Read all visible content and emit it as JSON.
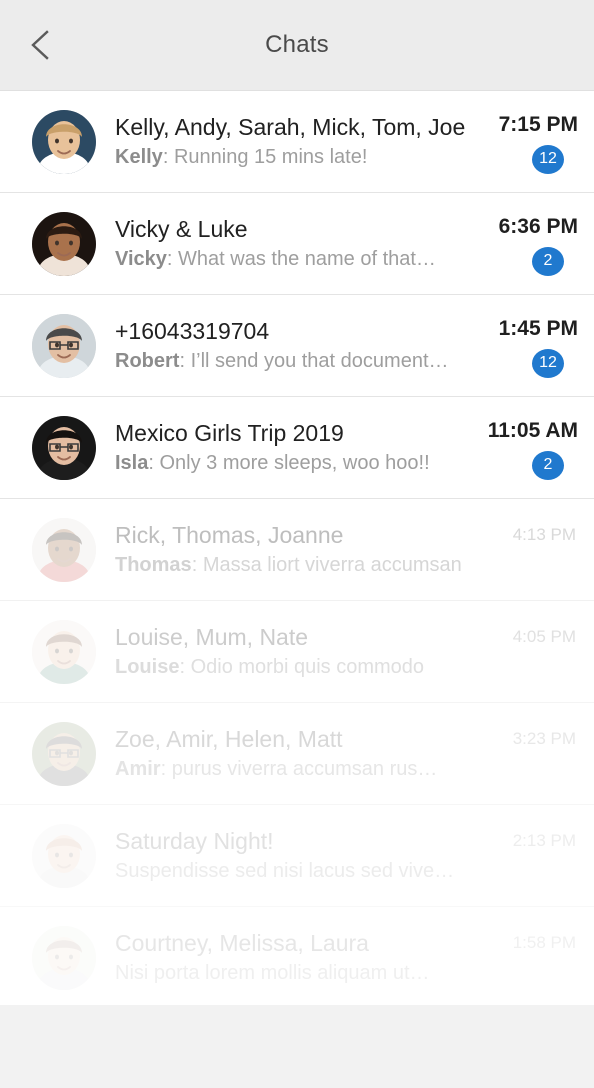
{
  "header": {
    "title": "Chats",
    "back_icon": "chevron-left-icon",
    "background": "#ececec"
  },
  "theme": {
    "badge_color": "#2079ce",
    "title_color": "#212121",
    "preview_color": "#9e9e9e",
    "divider_color": "#e4e4e4",
    "footer_color": "#f2f2f2"
  },
  "chats": [
    {
      "title": "Kelly, Andy, Sarah, Mick, Tom, Joe",
      "sender": "Kelly",
      "preview": "Running 15 mins late!",
      "time": "7:15 PM",
      "badge": "12",
      "unread": true,
      "avatar": "photo-young-man-blond"
    },
    {
      "title": "Vicky & Luke",
      "sender": "Vicky",
      "preview": "What was the name of that…",
      "time": "6:36 PM",
      "badge": "2",
      "unread": true,
      "avatar": "photo-woman-curly-hair"
    },
    {
      "title": "+16043319704",
      "sender": "Robert",
      "preview": "I’ll send you that document…",
      "time": "1:45 PM",
      "badge": "12",
      "unread": true,
      "avatar": "photo-man-glasses"
    },
    {
      "title": "Mexico Girls Trip 2019",
      "sender": "Isla",
      "preview": "Only 3 more sleeps, woo hoo!!",
      "time": "11:05 AM",
      "badge": "2",
      "unread": true,
      "avatar": "photo-woman-dark-hair-glasses"
    },
    {
      "title": "Rick, Thomas, Joanne",
      "sender": "Thomas",
      "preview": "Massa liort viverra accumsan",
      "time": "4:13 PM",
      "badge": "",
      "unread": false,
      "avatar": "photo-young-man-curly"
    },
    {
      "title": "Louise, Mum, Nate",
      "sender": "Louise",
      "preview": "Odio morbi quis commodo",
      "time": "4:05 PM",
      "badge": "",
      "unread": false,
      "avatar": "photo-woman-smiling-brown-hair"
    },
    {
      "title": "Zoe, Amir, Helen, Matt",
      "sender": "Amir",
      "preview": "purus viverra accumsan rus…",
      "time": "3:23 PM",
      "badge": "",
      "unread": false,
      "avatar": "photo-man-beard-glasses"
    },
    {
      "title": "Saturday Night!",
      "sender": "",
      "preview": "Suspendisse sed nisi lacus sed vive…",
      "time": "2:13 PM",
      "badge": "",
      "unread": false,
      "avatar": "photo-man-bald-beard"
    },
    {
      "title": "Courtney, Melissa, Laura",
      "sender": "",
      "preview": "Nisi porta lorem mollis aliquam ut…",
      "time": "1:58 PM",
      "badge": "",
      "unread": false,
      "avatar": "photo-woman-long-hair"
    }
  ]
}
